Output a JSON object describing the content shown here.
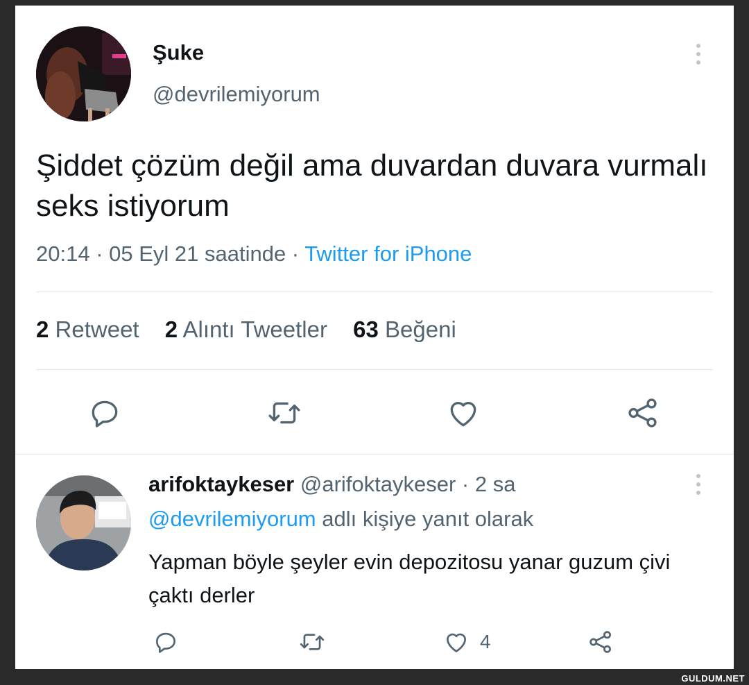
{
  "tweet": {
    "display_name": "Şuke",
    "handle": "@devrilemiyorum",
    "text": "Şiddet çözüm değil ama duvardan duvara vurmalı seks istiyorum",
    "time_date": "20:14 · 05 Eyl 21 saatinde · ",
    "source": "Twitter for iPhone",
    "stats": {
      "retweets_count": "2",
      "retweets_label": "Retweet",
      "quotes_count": "2",
      "quotes_label": "Alıntı Tweetler",
      "likes_count": "63",
      "likes_label": "Beğeni"
    },
    "actions": [
      "reply-icon",
      "retweet-icon",
      "like-icon",
      "share-icon"
    ]
  },
  "reply": {
    "display_name": "arifoktaykeser",
    "handle": "@arifoktaykeser",
    "time": " · 2 sa",
    "replying_to_handle": "@devrilemiyorum",
    "replying_to_suffix": " adlı kişiye yanıt olarak",
    "text": "Yapman böyle şeyler evin depozitosu yanar guzum çivi çaktı derler",
    "likes_count": "4"
  },
  "watermark": "GULDUM.NET",
  "colors": {
    "accent": "#1d9bf0",
    "text": "#0f1419",
    "secondary": "#536471",
    "divider": "#e1e8ed"
  }
}
